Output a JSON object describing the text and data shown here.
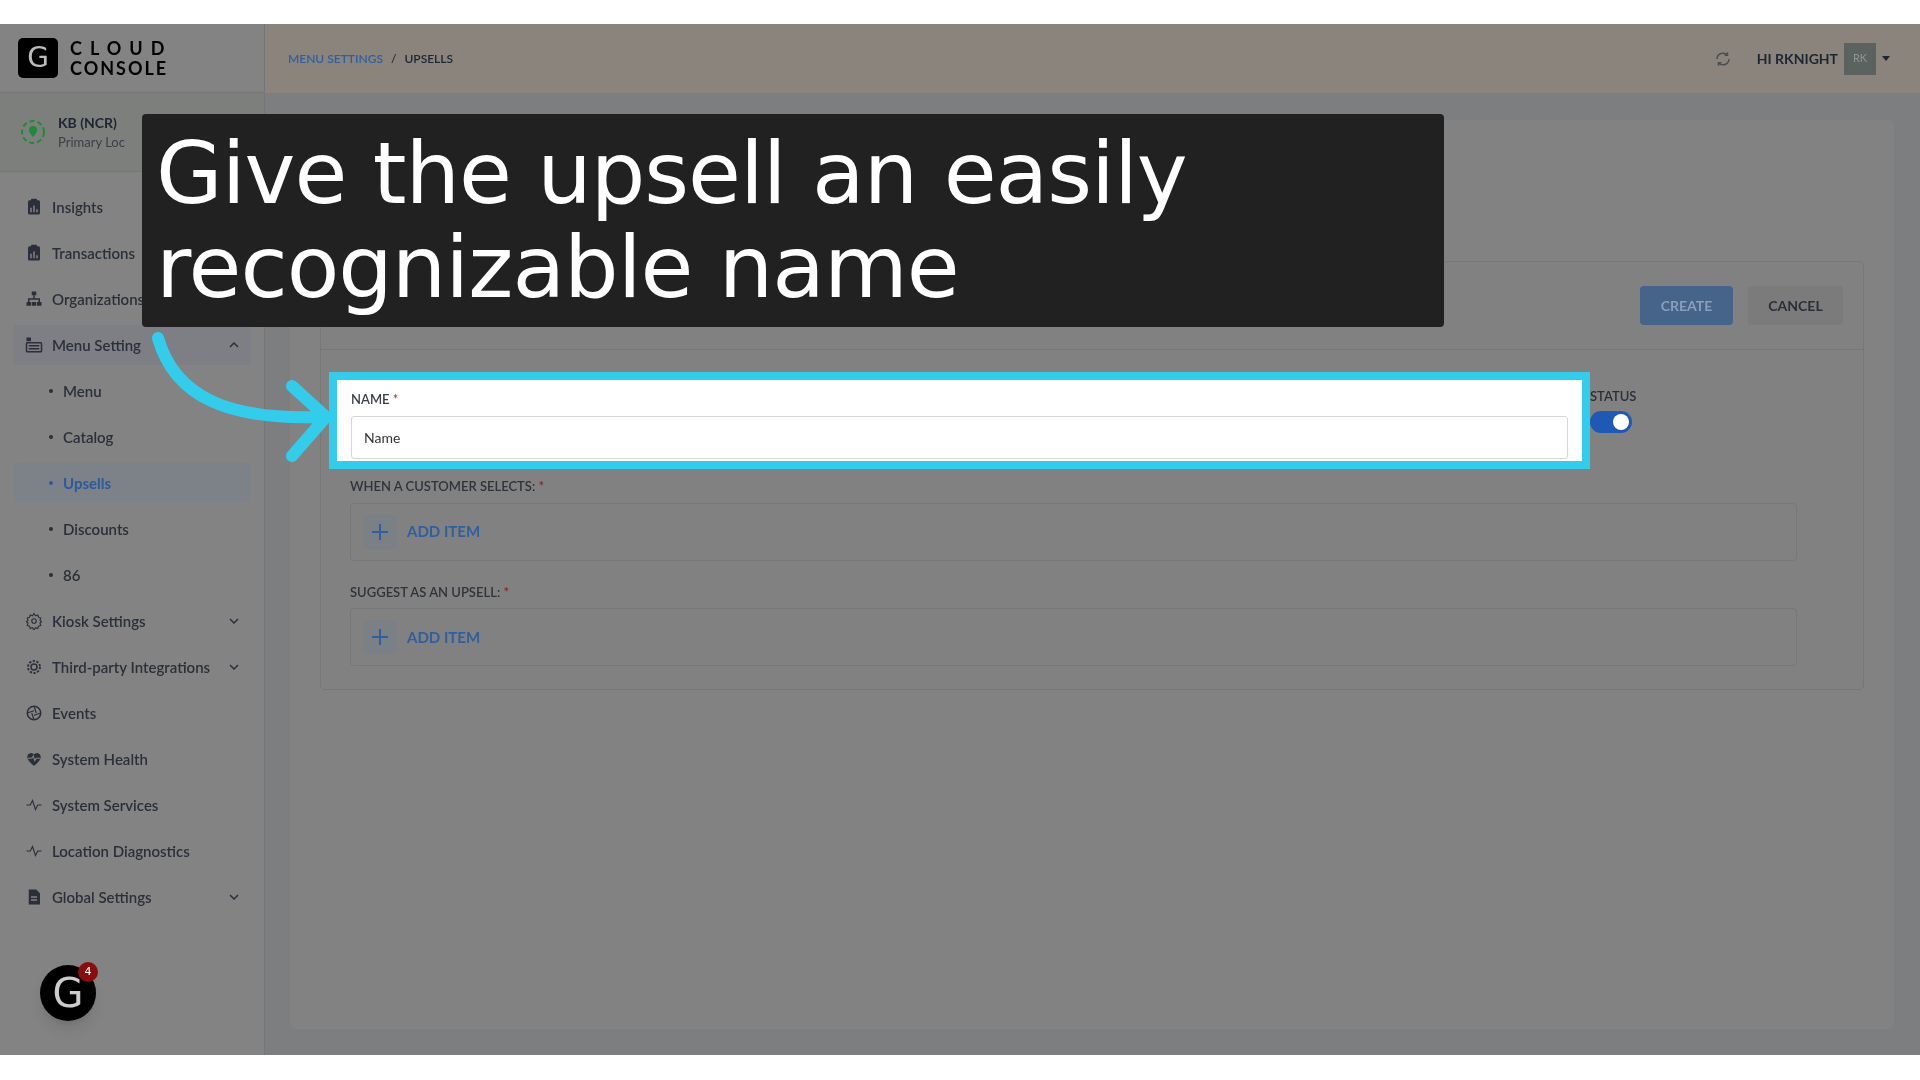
{
  "brand": {
    "logo_letter": "G",
    "line1": "CLOUD",
    "line2": "CONSOLE"
  },
  "breadcrumb": {
    "items": [
      {
        "label": "MENU SETTINGS",
        "kind": "link"
      },
      {
        "label": "UPSELLS",
        "kind": "current"
      }
    ],
    "separator": "/"
  },
  "user": {
    "greeting": "HI RKNIGHT",
    "initials": "RK"
  },
  "location": {
    "name": "KB (NCR)",
    "subtitle": "Primary Loc"
  },
  "sidebar": {
    "items": [
      {
        "label": "Insights"
      },
      {
        "label": "Transactions"
      },
      {
        "label": "Organizations"
      },
      {
        "label": "Menu Setting",
        "expanded": true,
        "children": [
          {
            "label": "Menu",
            "selected": false
          },
          {
            "label": "Catalog",
            "selected": false
          },
          {
            "label": "Upsells",
            "selected": true
          },
          {
            "label": "Discounts",
            "selected": false
          },
          {
            "label": "86",
            "selected": false
          }
        ]
      },
      {
        "label": "Kiosk Settings",
        "expanded": false
      },
      {
        "label": "Third-party Integrations",
        "expanded": false
      },
      {
        "label": "Events"
      },
      {
        "label": "System Health"
      },
      {
        "label": "System Services"
      },
      {
        "label": "Location Diagnostics"
      },
      {
        "label": "Global Settings",
        "expanded": false
      }
    ]
  },
  "help_button": {
    "letter": "G",
    "badge": "4"
  },
  "form": {
    "create": "CREATE",
    "cancel": "CANCEL",
    "name_field": {
      "label": "NAME",
      "required_mark": "*",
      "placeholder": "Name"
    },
    "status": {
      "label": "STATUS",
      "on": true
    },
    "sections": [
      {
        "label": "WHEN A CUSTOMER SELECTS:",
        "required_mark": "*",
        "button": "ADD ITEM"
      },
      {
        "label": "SUGGEST AS AN UPSELL:",
        "required_mark": "*",
        "button": "ADD ITEM"
      }
    ]
  },
  "caption": {
    "text": "Give the upsell an easily recognizable name"
  }
}
